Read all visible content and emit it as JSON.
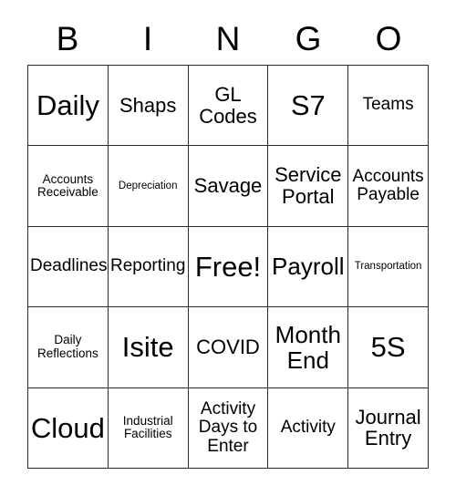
{
  "card": {
    "headers": [
      "B",
      "I",
      "N",
      "G",
      "O"
    ],
    "rows": [
      [
        {
          "label": "Daily",
          "size": "xxl"
        },
        {
          "label": "Shaps",
          "size": "lg"
        },
        {
          "label": "GL\nCodes",
          "size": "lg"
        },
        {
          "label": "S7",
          "size": "xxl"
        },
        {
          "label": "Teams",
          "size": "md"
        }
      ],
      [
        {
          "label": "Accounts\nReceivable",
          "size": "sm"
        },
        {
          "label": "Depreciation",
          "size": "xs"
        },
        {
          "label": "Savage",
          "size": "lg"
        },
        {
          "label": "Service\nPortal",
          "size": "lg"
        },
        {
          "label": "Accounts\nPayable",
          "size": "md"
        }
      ],
      [
        {
          "label": "Deadlines",
          "size": "md"
        },
        {
          "label": "Reporting",
          "size": "md"
        },
        {
          "label": "Free!",
          "size": "xxl"
        },
        {
          "label": "Payroll",
          "size": "xl"
        },
        {
          "label": "Transportation",
          "size": "xs"
        }
      ],
      [
        {
          "label": "Daily\nReflections",
          "size": "sm"
        },
        {
          "label": "Isite",
          "size": "xxl"
        },
        {
          "label": "COVID",
          "size": "lg"
        },
        {
          "label": "Month\nEnd",
          "size": "xl"
        },
        {
          "label": "5S",
          "size": "xxl"
        }
      ],
      [
        {
          "label": "Cloud",
          "size": "xxl"
        },
        {
          "label": "Industrial\nFacilities",
          "size": "sm"
        },
        {
          "label": "Activity\nDays to\nEnter",
          "size": "md"
        },
        {
          "label": "Activity",
          "size": "md"
        },
        {
          "label": "Journal\nEntry",
          "size": "lg"
        }
      ]
    ]
  },
  "colors": {
    "grid_line": "#2b2b2b",
    "text": "#000000",
    "background": "#ffffff"
  }
}
